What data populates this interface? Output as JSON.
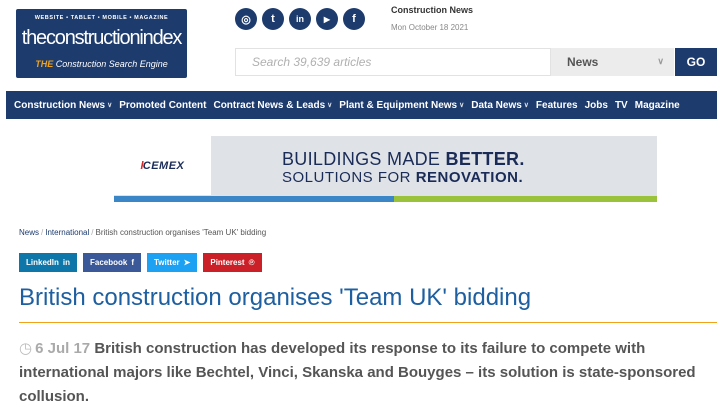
{
  "logo": {
    "tagline": "WEBSITE • TABLET • MOBILE • MAGAZINE",
    "name": "theconstructionindex",
    "sub_prefix": "THE",
    "sub_text": "Construction Search Engine"
  },
  "header": {
    "title": "Construction News",
    "date": "Mon October 18 2021"
  },
  "social": [
    {
      "icon": "instagram-icon",
      "glyph": "◎"
    },
    {
      "icon": "twitter-icon",
      "glyph": "t"
    },
    {
      "icon": "linkedin-icon",
      "glyph": "in"
    },
    {
      "icon": "youtube-icon",
      "glyph": "▶"
    },
    {
      "icon": "facebook-icon",
      "glyph": "f"
    }
  ],
  "search": {
    "placeholder": "Search 39,639 articles",
    "category": "News",
    "go_label": "GO"
  },
  "nav": [
    {
      "label": "Construction News",
      "dropdown": true
    },
    {
      "label": "Promoted Content",
      "dropdown": false
    },
    {
      "label": "Contract News & Leads",
      "dropdown": true
    },
    {
      "label": "Plant & Equipment News",
      "dropdown": true
    },
    {
      "label": "Data News",
      "dropdown": true
    },
    {
      "label": "Features",
      "dropdown": false
    },
    {
      "label": "Jobs",
      "dropdown": false
    },
    {
      "label": "TV",
      "dropdown": false
    },
    {
      "label": "Magazine",
      "dropdown": false
    }
  ],
  "banner": {
    "brand": "CEMEX",
    "line1_a": "BUILDINGS MADE ",
    "line1_b": "BETTER.",
    "line2_a": "SOLUTIONS FOR ",
    "line2_b": "RENOVATION."
  },
  "breadcrumb": {
    "items": [
      "News",
      "International"
    ],
    "current": "British construction organises 'Team UK' bidding"
  },
  "shares": [
    {
      "label": "LinkedIn",
      "glyph": "in",
      "color": "#0e76a8"
    },
    {
      "label": "Facebook",
      "glyph": "f",
      "color": "#3b5998"
    },
    {
      "label": "Twitter",
      "glyph": "🐦",
      "color": "#1da1f2"
    },
    {
      "label": "Pinterest",
      "glyph": "℗",
      "color": "#cb2027"
    }
  ],
  "article": {
    "title": "British construction organises 'Team UK' bidding",
    "date": "6 Jul 17",
    "lead": "British construction has developed its response to its failure to compete with international majors like Bechtel, Vinci, Skanska and Bouyges – its solution is state-sponsored collusion."
  },
  "colors": {
    "brand_navy": "#1d3b6d",
    "accent_orange": "#f0a31a",
    "title_blue": "#1d5fa0"
  }
}
